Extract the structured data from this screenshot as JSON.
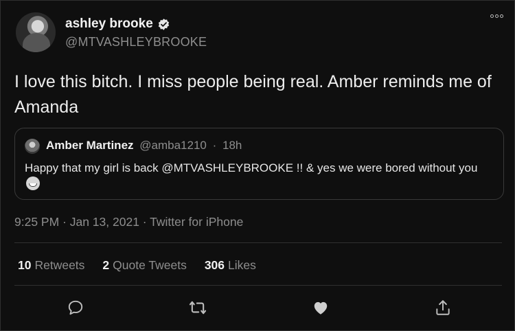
{
  "author": {
    "display_name": "ashley brooke",
    "handle": "@MTVASHLEYBROOKE",
    "verified_icon": "verified-badge-icon"
  },
  "tweet": {
    "text": "I love this bitch. I miss people being real. Amber reminds me of Amanda"
  },
  "quoted_tweet": {
    "name": "Amber Martinez",
    "handle": "@amba1210",
    "separator": "·",
    "time": "18h",
    "text": "Happy that my girl is back @MTVASHLEYBROOKE !! & yes we were bored without you",
    "emoji": "grinning-sweat-emoji"
  },
  "meta": {
    "line": "9:25 PM · Jan 13, 2021 · Twitter for iPhone"
  },
  "stats": {
    "retweets_count": "10",
    "retweets_label": "Retweets",
    "quotes_count": "2",
    "quotes_label": "Quote Tweets",
    "likes_count": "306",
    "likes_label": "Likes"
  },
  "actions": [
    "reply-icon",
    "retweet-icon",
    "like-icon",
    "share-icon"
  ]
}
